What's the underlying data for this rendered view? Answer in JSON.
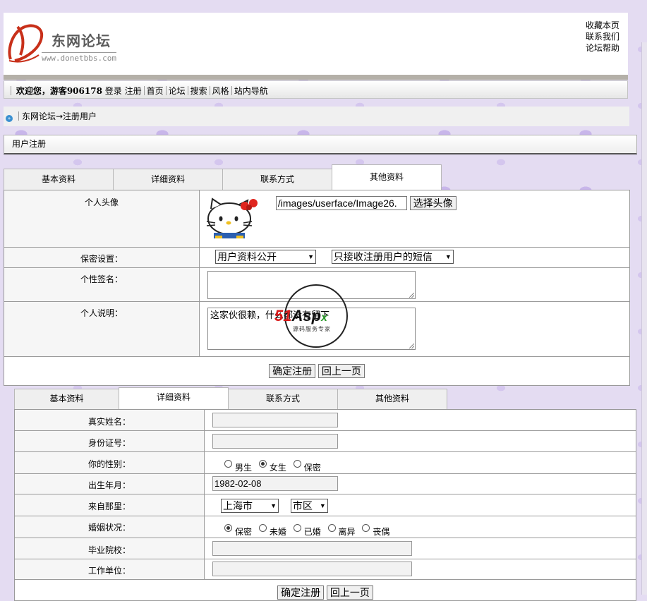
{
  "header": {
    "logo_title": "东网论坛",
    "logo_url": "www.donetbbs.com",
    "links": [
      "收藏本页",
      "联系我们",
      "论坛帮助"
    ]
  },
  "nav": {
    "welcome": "欢迎您，游客906178",
    "login": "登录",
    "register": "注册",
    "items": [
      "首页",
      "论坛",
      "搜索",
      "风格",
      "站内导航"
    ]
  },
  "breadcrumb": "东网论坛→注册用户",
  "section_title": "用户注册",
  "tabs": [
    "基本资料",
    "详细资料",
    "联系方式",
    "其他资料"
  ],
  "form1": {
    "active_tab": "其他资料",
    "avatar_label": "个人头像",
    "avatar_path": "/images/userface/Image26.",
    "avatar_button": "选择头像",
    "privacy_label": "保密设置：",
    "privacy_option1": "用户资料公开",
    "privacy_option2": "只接收注册用户的短信",
    "signature_label": "个性签名：",
    "signature_value": "",
    "intro_label": "个人说明：",
    "intro_value": "这家伙很赖，什么都没有留下",
    "submit": "确定注册",
    "back": "回上一页"
  },
  "form2": {
    "active_tab": "详细资料",
    "realname_label": "真实姓名：",
    "idcard_label": "身份证号：",
    "gender_label": "你的性别：",
    "gender_options": [
      "男生",
      "女生",
      "保密"
    ],
    "gender_selected": "女生",
    "birthday_label": "出生年月：",
    "birthday_value": "1982-02-08",
    "from_label": "来自那里：",
    "city": "上海市",
    "district": "市区",
    "marital_label": "婚姻状况：",
    "marital_options": [
      "保密",
      "未婚",
      "已婚",
      "离异",
      "丧偶"
    ],
    "marital_selected": "保密",
    "school_label": "毕业院校：",
    "company_label": "工作单位：",
    "submit": "确定注册",
    "back": "回上一页"
  },
  "watermark": {
    "brand_red": "51",
    "brand_black": "Asp",
    "brand_green": "x",
    "slogan": "源码服务专家"
  },
  "colors": {
    "background": "#e4dcf2",
    "nav_gradient_top": "#ffffff",
    "watermark_red": "#d81818",
    "watermark_green": "#2a9a2a"
  }
}
